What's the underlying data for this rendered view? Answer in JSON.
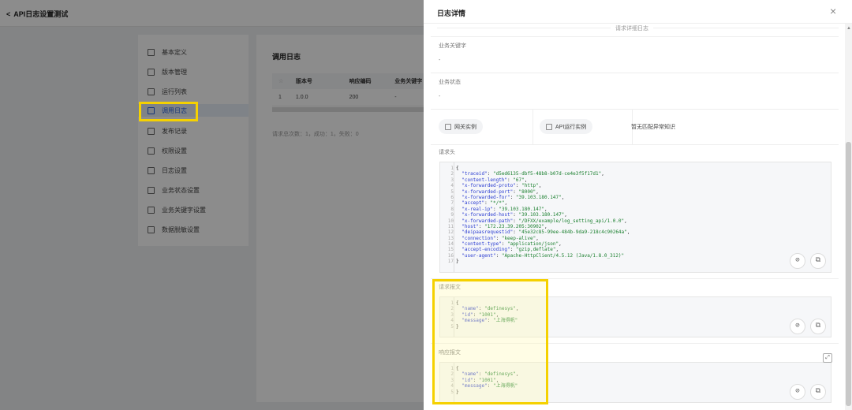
{
  "app": {
    "title": "API日志设置测试",
    "back_glyph": "<"
  },
  "sidebar": {
    "items": [
      {
        "label": "基本定义",
        "icon": "document-icon"
      },
      {
        "label": "版本管理",
        "icon": "version-icon"
      },
      {
        "label": "运行列表",
        "icon": "list-icon"
      },
      {
        "label": "调用日志",
        "icon": "log-icon",
        "active": true
      },
      {
        "label": "发布记录",
        "icon": "send-icon"
      },
      {
        "label": "权限设置",
        "icon": "permission-icon"
      },
      {
        "label": "日志设置",
        "icon": "log-settings-icon"
      },
      {
        "label": "业务状态设置",
        "icon": "status-settings-icon"
      },
      {
        "label": "业务关键字设置",
        "icon": "keyword-settings-icon"
      },
      {
        "label": "数据脱敏设置",
        "icon": "masking-icon"
      }
    ]
  },
  "main": {
    "title": "调用日志",
    "headers": [
      "☆",
      "版本号",
      "响应编码",
      "业务关键字"
    ],
    "rows": [
      {
        "c0": "1",
        "c1": "1.0.0",
        "c2": "200",
        "c3": "-"
      }
    ],
    "stats": "请求总次数：1，成功：1，失败：0"
  },
  "drawer": {
    "title": "日志详情",
    "close_glyph": "×",
    "section_title": "请求详细日志",
    "keyword_label": "业务关键字",
    "keyword_value": "-",
    "status_label": "业务状态",
    "status_value": "-",
    "gateway_chip": "网关实例",
    "runtime_chip": "API运行实例",
    "no_match": "暂无匹配异常知识",
    "request_header_label": "请求头",
    "request_body_label": "请求报文",
    "response_body_label": "响应报文",
    "request_header_code": [
      "{",
      "  \"traceid\": \"d5ed6135-dbf5-48b8-b07d-ce4e3f5f17d1\",",
      "  \"content-length\": \"67\",",
      "  \"x-forwarded-proto\": \"http\",",
      "  \"x-forwarded-port\": \"8000\",",
      "  \"x-forwarded-for\": \"39.103.180.147\",",
      "  \"accept\": \"*/*\",",
      "  \"x-real-ip\": \"39.103.180.147\",",
      "  \"x-forwarded-host\": \"39.103.180.147\",",
      "  \"x-forwarded-path\": \"/DFXX/example/log_setting_api/1.0.0\",",
      "  \"host\": \"172.23.39.205:30902\",",
      "  \"deipaasrequestid\": \"45e32c85-99ee-484b-9da9-218c4c90264a\",",
      "  \"connection\": \"keep-alive\",",
      "  \"content-type\": \"application/json\",",
      "  \"accept-encoding\": \"gzip,deflate\",",
      "  \"user-agent\": \"Apache-HttpClient/4.5.12 (Java/1.8.0_312)\"",
      "}"
    ],
    "request_body_code": [
      "{",
      "  \"name\": \"definesys\",",
      "  \"id\": \"1001\",",
      "  \"message\": \"上海得帆\"",
      "}"
    ],
    "response_body_code": [
      "{",
      "  \"name\": \"definesys\",",
      "  \"id\": \"1001\",",
      "  \"message\": \"上海得帆\"",
      "}"
    ],
    "copy_glyph": "⧉",
    "link_glyph": "⊘"
  },
  "colors": {
    "accent": "#2b63d9",
    "highlight": "#f5d100",
    "key": "#2b3dd1",
    "string": "#1a7f2e"
  }
}
